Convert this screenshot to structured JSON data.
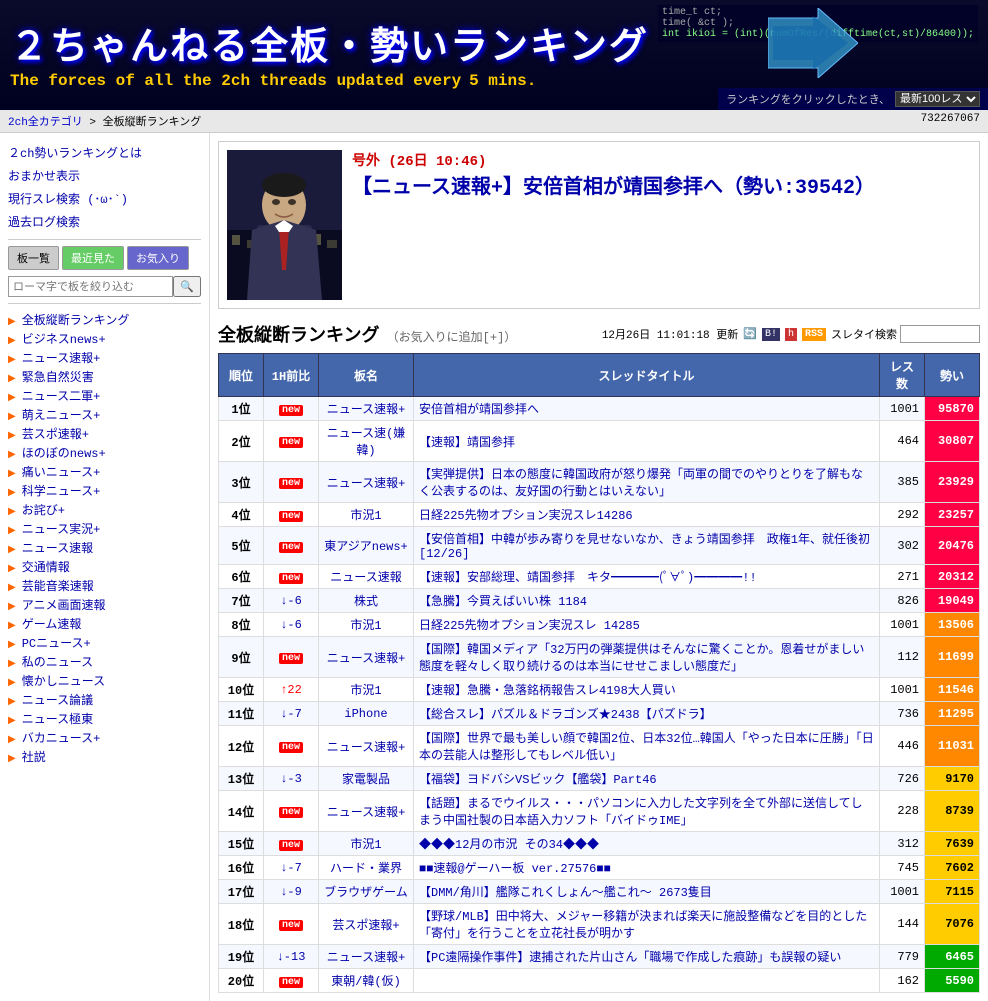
{
  "header": {
    "title": "２ちゃんねる全板・勢いランキング",
    "subtitle": "The forces of all the 2ch threads updated every",
    "subtitle_highlight": "5 mins.",
    "code_line1": "time_t ct;",
    "code_line2": "time( &ct );",
    "code_line3": "int ikioi = (int)(numOfRes/(difftime(ct,st)/86400));",
    "bar_label": "ランキングをクリックしたとき、",
    "bar_select": "最新100レス"
  },
  "breadcrumb": {
    "home": "2ch全カテゴリ",
    "current": "全板縦断ランキング",
    "id": "732267067"
  },
  "breaking": {
    "label": "号外 (26日 10:46)",
    "title": "【ニュース速報+】安倍首相が靖国参拝へ（勢い:39542）"
  },
  "sidebar": {
    "links": [
      {
        "label": "2ch勢いランキングとは",
        "href": "#"
      },
      {
        "label": "おまかせ表示",
        "href": "#"
      },
      {
        "label": "現行スレ検索 (･ω･`)",
        "href": "#"
      },
      {
        "label": "過去ログ検索",
        "href": "#"
      }
    ],
    "buttons": [
      {
        "label": "板一覧",
        "style": "gray"
      },
      {
        "label": "最近見た",
        "style": "green"
      },
      {
        "label": "お気入り",
        "style": "blue"
      }
    ],
    "search_placeholder": "ローマ字で板を絞り込む",
    "list": [
      "全板縦断ランキング",
      "ビジネスnews+",
      "ニュース速報+",
      "緊急自然災害",
      "ニュース二軍+",
      "萌えニュース+",
      "芸スポ速報+",
      "ほのぼのnews+",
      "痛いニュース+",
      "科学ニュース+",
      "お詫び+",
      "ニュース実況+",
      "ニュース速報",
      "交通情報",
      "芸能音楽速報",
      "アニメ画面速報",
      "ゲーム速報",
      "PCニュース+",
      "私のニュース",
      "懐かしニュース",
      "ニュース論議",
      "ニュース極東",
      "バカニュース+",
      "社説"
    ]
  },
  "ranking": {
    "title": "全板縦断ランキング",
    "subtitle": "（お気入りに追加[+]）",
    "updated": "12月26日 11:01:18 更新",
    "search_label": "スレタイ検索",
    "columns": {
      "rank": "順位",
      "change": "1H前比",
      "board": "板名",
      "title": "スレッドタイトル",
      "res": "レス数",
      "ikioi": "勢い"
    },
    "rows": [
      {
        "rank": "1位",
        "change": "new",
        "change_type": "new",
        "board": "ニュース速報+",
        "title": "安倍首相が靖国参拝へ",
        "res": "1001",
        "ikioi": "95870",
        "ikioi_class": "ikioi-red"
      },
      {
        "rank": "2位",
        "change": "new",
        "change_type": "new",
        "board": "ニュース速(嫌韓)",
        "title": "【速報】靖国参拝",
        "res": "464",
        "ikioi": "30807",
        "ikioi_class": "ikioi-red"
      },
      {
        "rank": "3位",
        "change": "new",
        "change_type": "new",
        "board": "ニュース速報+",
        "title": "【実弾提供】日本の態度に韓国政府が怒り爆発「両軍の間でのやりとりを了解もなく公表するのは、友好国の行動とはいえない」",
        "res": "385",
        "ikioi": "23929",
        "ikioi_class": "ikioi-red"
      },
      {
        "rank": "4位",
        "change": "new",
        "change_type": "new",
        "board": "市況1",
        "title": "日経225先物オプション実況スレ14286",
        "res": "292",
        "ikioi": "23257",
        "ikioi_class": "ikioi-red"
      },
      {
        "rank": "5位",
        "change": "new",
        "change_type": "new",
        "board": "東アジアnews+",
        "title": "【安倍首相】中韓が歩み寄りを見せないなか、きょう靖国参拝　政権1年、就任後初[12/26]",
        "res": "302",
        "ikioi": "20476",
        "ikioi_class": "ikioi-red"
      },
      {
        "rank": "6位",
        "change": "new",
        "change_type": "new",
        "board": "ニュース速報",
        "title": "【速報】安部総理、靖国参拝　キタ━━━━(ﾟ∀ﾟ)━━━━!!",
        "res": "271",
        "ikioi": "20312",
        "ikioi_class": "ikioi-red"
      },
      {
        "rank": "7位",
        "change": "↓-6",
        "change_type": "down",
        "board": "株式",
        "title": "【急騰】今買えばいい株 1184",
        "res": "826",
        "ikioi": "19049",
        "ikioi_class": "ikioi-red"
      },
      {
        "rank": "8位",
        "change": "↓-6",
        "change_type": "down",
        "board": "市況1",
        "title": "日経225先物オプション実況スレ 14285",
        "res": "1001",
        "ikioi": "13506",
        "ikioi_class": "ikioi-orange"
      },
      {
        "rank": "9位",
        "change": "new",
        "change_type": "new",
        "board": "ニュース速報+",
        "title": "【国際】韓国メディア「32万円の弾薬提供はそんなに驚くことか。恩着せがましい態度を軽々しく取り続けるのは本当にせせこましい態度だ」",
        "res": "112",
        "ikioi": "11699",
        "ikioi_class": "ikioi-orange"
      },
      {
        "rank": "10位",
        "change": "↑22",
        "change_type": "up",
        "board": "市況1",
        "title": "【速報】急騰・急落銘柄報告スレ4198大人買い",
        "res": "1001",
        "ikioi": "11546",
        "ikioi_class": "ikioi-orange"
      },
      {
        "rank": "11位",
        "change": "↓-7",
        "change_type": "down",
        "board": "iPhone",
        "title": "【総合スレ】パズル＆ドラゴンズ★2438【パズドラ】",
        "res": "736",
        "ikioi": "11295",
        "ikioi_class": "ikioi-orange"
      },
      {
        "rank": "12位",
        "change": "new",
        "change_type": "new",
        "board": "ニュース速報+",
        "title": "【国際】世界で最も美しい顔で韓国2位、日本32位…韓国人「やった日本に圧勝」「日本の芸能人は整形してもレベル低い」",
        "res": "446",
        "ikioi": "11031",
        "ikioi_class": "ikioi-orange"
      },
      {
        "rank": "13位",
        "change": "↓-3",
        "change_type": "down",
        "board": "家電製品",
        "title": "【福袋】ヨドバシVSビック【艦袋】Part46",
        "res": "726",
        "ikioi": "9170",
        "ikioi_class": "ikioi-yellow"
      },
      {
        "rank": "14位",
        "change": "new",
        "change_type": "new",
        "board": "ニュース速報+",
        "title": "【話題】まるでウイルス・・・パソコンに入力した文字列を全て外部に送信してしまう中国社製の日本語入力ソフト「バイドゥIME」",
        "res": "228",
        "ikioi": "8739",
        "ikioi_class": "ikioi-yellow"
      },
      {
        "rank": "15位",
        "change": "new",
        "change_type": "new",
        "board": "市況1",
        "title": "◆◆◆12月の市況 その34◆◆◆",
        "res": "312",
        "ikioi": "7639",
        "ikioi_class": "ikioi-yellow"
      },
      {
        "rank": "16位",
        "change": "↓-7",
        "change_type": "down",
        "board": "ハード・業界",
        "title": "■■速報@ゲーハー板 ver.27576■■",
        "res": "745",
        "ikioi": "7602",
        "ikioi_class": "ikioi-yellow"
      },
      {
        "rank": "17位",
        "change": "↓-9",
        "change_type": "down",
        "board": "ブラウザゲーム",
        "title": "【DMM/角川】艦隊これくしょん～艦これ～ 2673隻目",
        "res": "1001",
        "ikioi": "7115",
        "ikioi_class": "ikioi-yellow"
      },
      {
        "rank": "18位",
        "change": "new",
        "change_type": "new",
        "board": "芸スポ速報+",
        "title": "【野球/MLB】田中将大、メジャー移籍が決まれば楽天に施設整備などを目的とした「寄付」を行うことを立花社長が明かす",
        "res": "144",
        "ikioi": "7076",
        "ikioi_class": "ikioi-yellow"
      },
      {
        "rank": "19位",
        "change": "↓-13",
        "change_type": "down",
        "board": "ニュース速報+",
        "title": "【PC遠隔操作事件】逮捕された片山さん「職場で作成した痕跡」も誤報の疑い",
        "res": "779",
        "ikioi": "6465",
        "ikioi_class": "ikioi-green"
      },
      {
        "rank": "20位",
        "change": "new",
        "change_type": "new",
        "board": "東朝/韓(仮)",
        "title": "",
        "res": "162",
        "ikioi": "5590",
        "ikioi_class": "ikioi-green"
      }
    ]
  }
}
